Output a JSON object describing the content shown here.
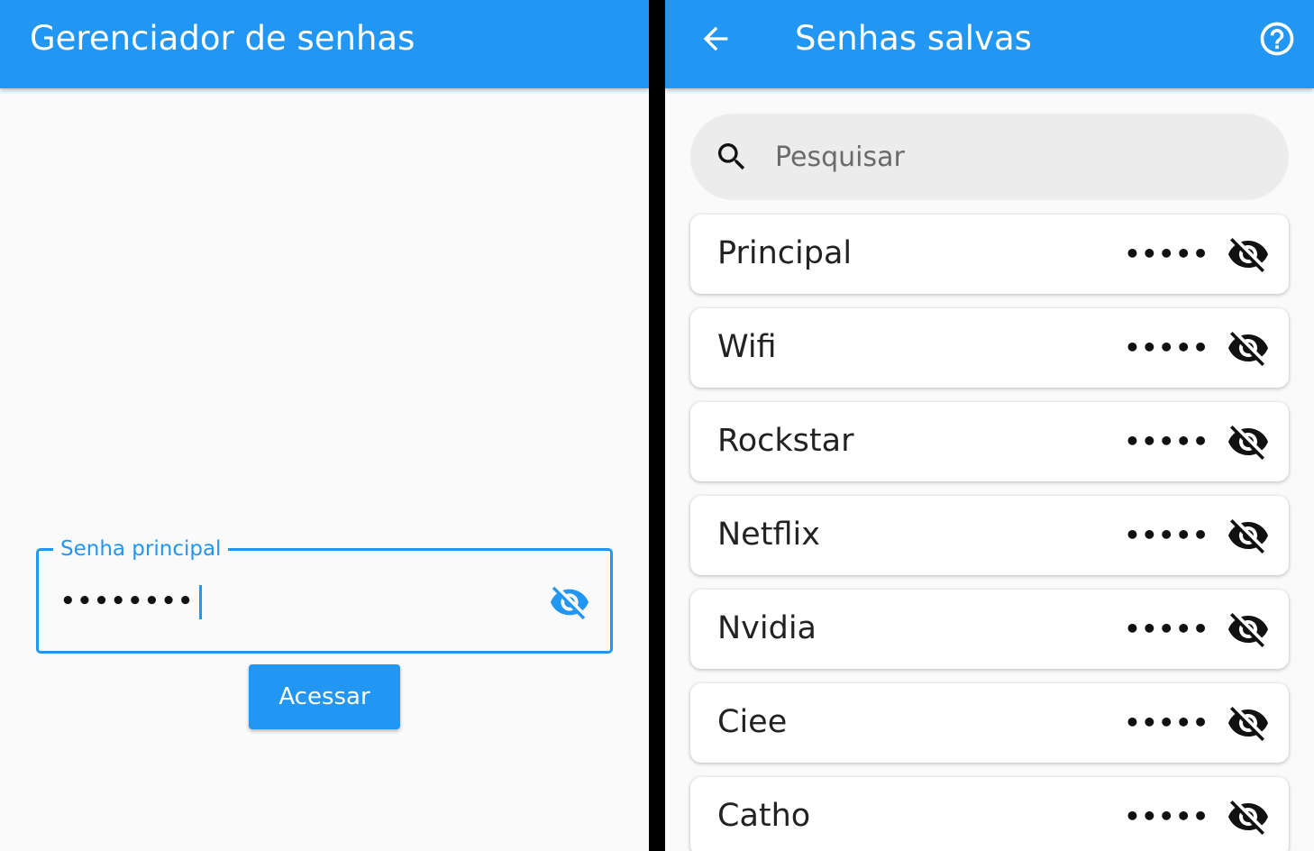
{
  "left_screen": {
    "appbar": {
      "title": "Gerenciador de senhas"
    },
    "password_field": {
      "label": "Senha principal",
      "value": "••••••••",
      "toggle_icon": "visibility-off-icon"
    },
    "access_button": {
      "label": "Acessar"
    }
  },
  "right_screen": {
    "appbar": {
      "title": "Senhas salvas",
      "back_icon": "arrow-back-icon",
      "help_icon": "help-circle-icon"
    },
    "search": {
      "placeholder": "Pesquisar",
      "value": "",
      "icon": "search-icon"
    },
    "items": [
      {
        "name": "Principal",
        "masked": "•••••",
        "icon": "visibility-off-icon"
      },
      {
        "name": "Wifi",
        "masked": "•••••",
        "icon": "visibility-off-icon"
      },
      {
        "name": "Rockstar",
        "masked": "•••••",
        "icon": "visibility-off-icon"
      },
      {
        "name": "Netflix",
        "masked": "•••••",
        "icon": "visibility-off-icon"
      },
      {
        "name": "Nvidia",
        "masked": "•••••",
        "icon": "visibility-off-icon"
      },
      {
        "name": "Ciee",
        "masked": "•••••",
        "icon": "visibility-off-icon"
      },
      {
        "name": "Catho",
        "masked": "•••••",
        "icon": "visibility-off-icon"
      }
    ]
  },
  "colors": {
    "primary": "#2196f3",
    "background": "#fafafa",
    "search_bg": "#ececec",
    "text": "#222222",
    "divider": "#000000"
  }
}
